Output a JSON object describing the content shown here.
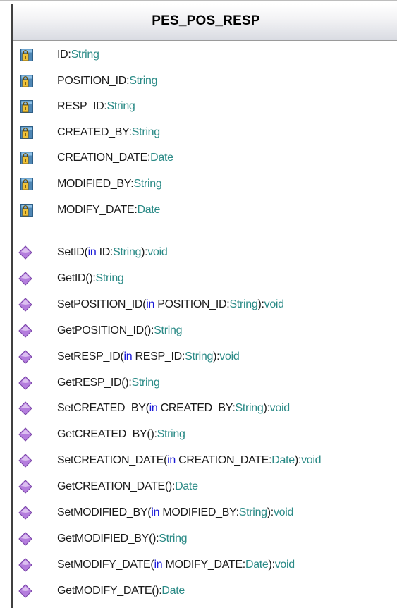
{
  "class": {
    "name": "PES_POS_RESP",
    "attributes": [
      {
        "name": "ID",
        "type": "String"
      },
      {
        "name": "POSITION_ID",
        "type": "String"
      },
      {
        "name": "RESP_ID",
        "type": "String"
      },
      {
        "name": "CREATED_BY",
        "type": "String"
      },
      {
        "name": "CREATION_DATE",
        "type": "Date"
      },
      {
        "name": "MODIFIED_BY",
        "type": "String"
      },
      {
        "name": "MODIFY_DATE",
        "type": "Date"
      }
    ],
    "operations": [
      {
        "name": "SetID",
        "param_dir": "in",
        "param_name": "ID",
        "param_type": "String",
        "return_type": "void"
      },
      {
        "name": "GetID",
        "return_type": "String"
      },
      {
        "name": "SetPOSITION_ID",
        "param_dir": "in",
        "param_name": "POSITION_ID",
        "param_type": "String",
        "return_type": "void"
      },
      {
        "name": "GetPOSITION_ID",
        "return_type": "String"
      },
      {
        "name": "SetRESP_ID",
        "param_dir": "in",
        "param_name": "RESP_ID",
        "param_type": "String",
        "return_type": "void"
      },
      {
        "name": "GetRESP_ID",
        "return_type": "String"
      },
      {
        "name": "SetCREATED_BY",
        "param_dir": "in",
        "param_name": "CREATED_BY",
        "param_type": "String",
        "return_type": "void"
      },
      {
        "name": "GetCREATED_BY",
        "return_type": "String"
      },
      {
        "name": "SetCREATION_DATE",
        "param_dir": "in",
        "param_name": "CREATION_DATE",
        "param_type": "Date",
        "return_type": "void"
      },
      {
        "name": "GetCREATION_DATE",
        "return_type": "Date"
      },
      {
        "name": "SetMODIFIED_BY",
        "param_dir": "in",
        "param_name": "MODIFIED_BY",
        "param_type": "String",
        "return_type": "void"
      },
      {
        "name": "GetMODIFIED_BY",
        "return_type": "String"
      },
      {
        "name": "SetMODIFY_DATE",
        "param_dir": "in",
        "param_name": "MODIFY_DATE",
        "param_type": "Date",
        "return_type": "void"
      },
      {
        "name": "GetMODIFY_DATE",
        "return_type": "Date"
      }
    ]
  },
  "icons": {
    "attribute": "private-attribute-icon",
    "operation": "public-operation-icon"
  },
  "colors": {
    "name_text": "#1a1a1a",
    "type_text": "#2a8a86",
    "keyword_text": "#1919d8",
    "operation_icon": "#b07ad8"
  }
}
